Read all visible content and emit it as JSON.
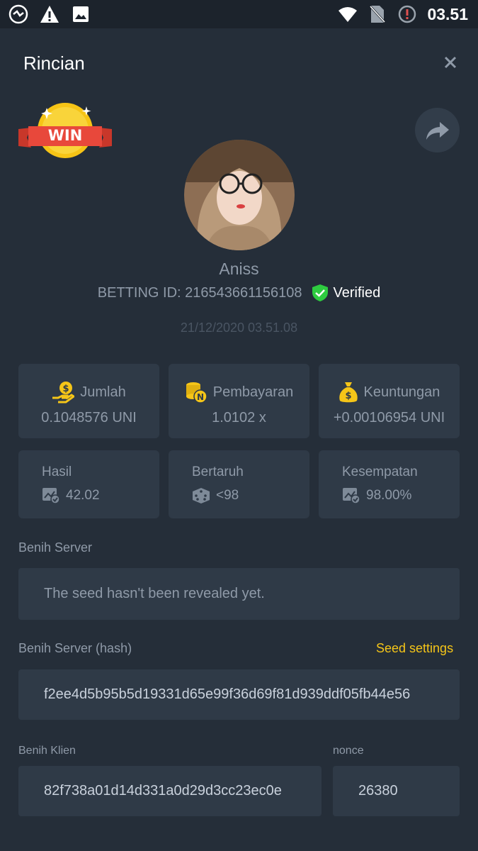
{
  "status_bar": {
    "time": "03.51"
  },
  "header": {
    "title": "Rincian"
  },
  "win_badge": "WIN",
  "user": {
    "name": "Aniss",
    "betting_id": "BETTING ID: 216543661156108",
    "verified_label": "Verified",
    "date": "21/12/2020 03.51.08"
  },
  "stats": [
    {
      "label": "Jumlah",
      "value": "0.1048576 UNI"
    },
    {
      "label": "Pembayaran",
      "value": "1.0102 x"
    },
    {
      "label": "Keuntungan",
      "value": "+0.00106954 UNI"
    }
  ],
  "results": [
    {
      "label": "Hasil",
      "value": "42.02"
    },
    {
      "label": "Bertaruh",
      "value": "<98"
    },
    {
      "label": "Kesempatan",
      "value": "98.00%"
    }
  ],
  "server_seed": {
    "label": "Benih Server",
    "value": "The seed hasn't been revealed yet."
  },
  "server_seed_hash": {
    "label": "Benih Server (hash)",
    "settings_link": "Seed settings",
    "value": "f2ee4d5b95b5d19331d65e99f36d69f81d939ddf05fb44e56"
  },
  "client_seed": {
    "label": "Benih Klien",
    "value": "82f738a01d14d331a0d29d3cc23ec0e"
  },
  "nonce": {
    "label": "nonce",
    "value": "26380"
  },
  "colors": {
    "background": "#252e39",
    "card": "#2f3a47",
    "accent": "#f5c518",
    "verified": "#2ecc40"
  }
}
